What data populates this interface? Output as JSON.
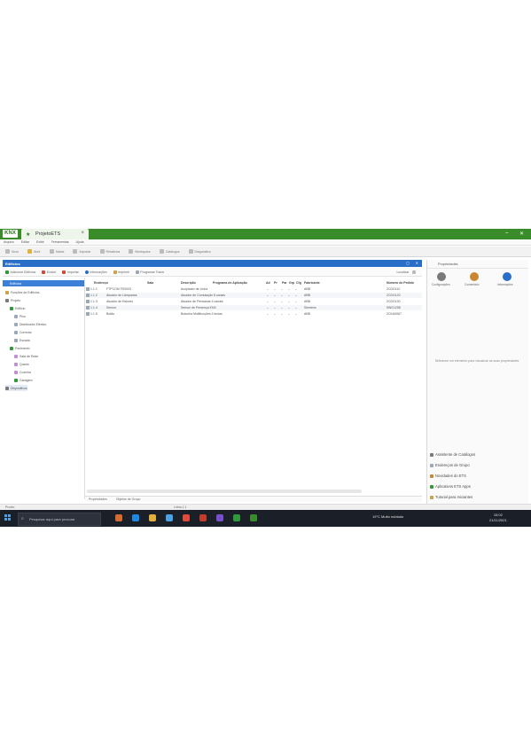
{
  "app": {
    "logo": "KNX",
    "tab_title": "ProjetoETS",
    "window_controls": [
      "–",
      "✕"
    ]
  },
  "menu": [
    "Arquivo",
    "Editar",
    "Exibir",
    "Ferramentas",
    "Ajuda"
  ],
  "toolbar": [
    "Novo",
    "Abrir",
    "Salvar",
    "Importar",
    "Relatórios",
    "Workspace",
    "Catálogos",
    "Diagnóstico"
  ],
  "panel": {
    "title": "Edifícios",
    "actions": [
      "Adicionar Edifícios",
      "Excluir",
      "Importar",
      "Informações",
      "Imprimir",
      "Programar Todos",
      "Localizar"
    ]
  },
  "tree": {
    "header": "Edifícios",
    "items": [
      {
        "label": "Funções de Edifícios",
        "indent": 0,
        "color": "#c9a24a"
      },
      {
        "label": "Projeto",
        "indent": 0,
        "color": "#7a7a7a"
      },
      {
        "label": "Edifício",
        "indent": 1,
        "color": "#2f9a3a"
      },
      {
        "label": "Piso",
        "indent": 2,
        "color": "#9aa8b8"
      },
      {
        "label": "Distribuidor Elétrico",
        "indent": 2,
        "color": "#9aa8b8"
      },
      {
        "label": "Corredor",
        "indent": 2,
        "color": "#9aa8b8"
      },
      {
        "label": "Escada",
        "indent": 2,
        "color": "#9aa8b8"
      },
      {
        "label": "Pavimento",
        "indent": 1,
        "color": "#2f9a3a"
      },
      {
        "label": "Sala de Estar",
        "indent": 2,
        "color": "#c48fd0"
      },
      {
        "label": "Quarto",
        "indent": 2,
        "color": "#c48fd0"
      },
      {
        "label": "Cozinha",
        "indent": 2,
        "color": "#c48fd0"
      },
      {
        "label": "Garagem",
        "indent": 2,
        "color": "#2f9a3a"
      },
      {
        "label": "Dispositivos",
        "indent": 0,
        "color": "#7a7a7a"
      }
    ]
  },
  "table": {
    "columns": [
      "Endereço",
      "Sala",
      "Descrição",
      "Programa de Aplicação",
      "Ad",
      "Pr",
      "Par",
      "Grp",
      "Cfg",
      "Fabricante",
      "Número de Pedido"
    ],
    "rows": [
      {
        "addr": "1.1.1",
        "name": "FTPCOM FS0003",
        "desc": "",
        "app": "Acoplador de Linha",
        "manuf": "ABB",
        "order": "2CDG110"
      },
      {
        "addr": "1.1.2",
        "name": "Atuador de Lâmpadas",
        "desc": "",
        "app": "Atuador de Comutação 8 canais",
        "manuf": "ABB",
        "order": "2CDG120"
      },
      {
        "addr": "1.1.3",
        "name": "Atuador de Estores",
        "desc": "",
        "app": "Atuador de Persianas 4 canais",
        "manuf": "ABB",
        "order": "2CDG130"
      },
      {
        "addr": "1.1.4",
        "name": "Sensor",
        "desc": "",
        "app": "Sensor de Presença KNX",
        "manuf": "Siemens",
        "order": "5WG1258"
      },
      {
        "addr": "1.1.5",
        "name": "Botão",
        "desc": "",
        "app": "Botoeira Multifunções 4 teclas",
        "manuf": "ABB",
        "order": "2CKA0067"
      }
    ],
    "bottom_tabs": [
      "Propriedades",
      "Objetos de Grupo"
    ]
  },
  "right_panel": {
    "title": "Propriedades",
    "icons": [
      {
        "label": "Configurações",
        "color": "#7a7a7a"
      },
      {
        "label": "Comentário",
        "color": "#c9882f"
      },
      {
        "label": "Informações",
        "color": "#2a6fc7"
      }
    ],
    "empty_message": "Selecione um elemento para visualizar as suas propriedades",
    "links": [
      {
        "label": "Assistente de Catálogos",
        "color": "#7a7a7a"
      },
      {
        "label": "Endereços de Grupo",
        "color": "#9aa8b8"
      },
      {
        "label": "Novidades do ETS",
        "color": "#c9882f"
      },
      {
        "label": "Aplicativos ETS Apps",
        "color": "#2f9a3a"
      },
      {
        "label": "Tutorial para Iniciantes",
        "color": "#c9a24a"
      }
    ]
  },
  "status": {
    "left": "Pronto",
    "center": "Linha 1.1"
  },
  "taskbar": {
    "search_placeholder": "Pesquisar aqui para procurar",
    "weather": "19°C  Muito nublado",
    "time": "15:02",
    "date": "21/11/2021",
    "icon_colors": [
      "#d36a2f",
      "#1e88e5",
      "#e0b23c",
      "#4ba3e3",
      "#e04c3c",
      "#c23b2b",
      "#7a4fcf",
      "#2f9a3a",
      "#3a8c2a"
    ]
  }
}
